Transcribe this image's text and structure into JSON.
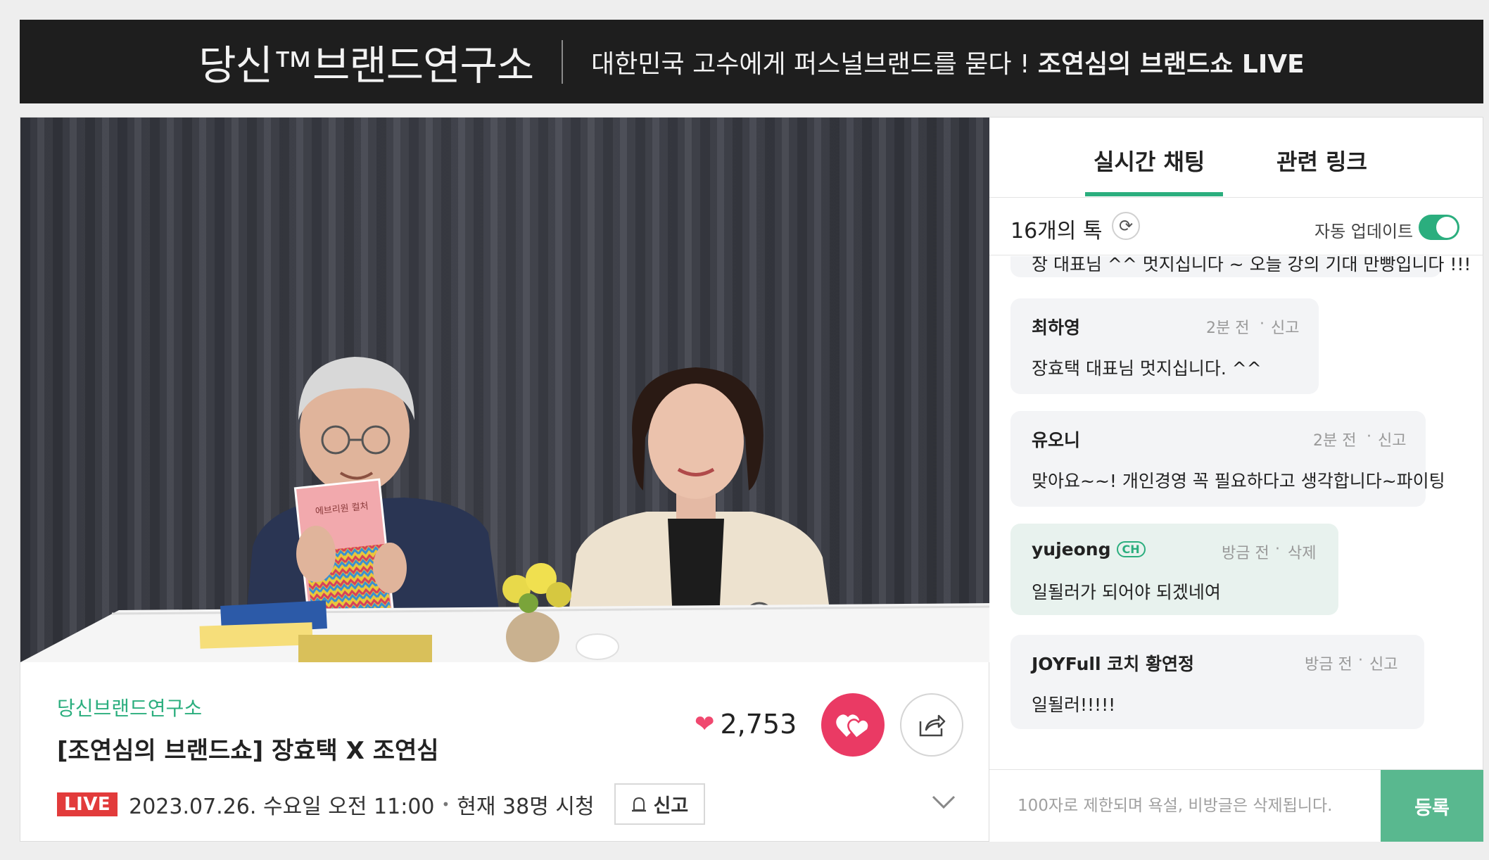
{
  "banner": {
    "logo": "당신™브랜드연구소",
    "tagline_normal": "대한민국 고수에게 퍼스널브랜드를 묻다 ! ",
    "tagline_bold": "조연심의 브랜드쇼 LIVE"
  },
  "video": {
    "book_title": "에브리원 컬처"
  },
  "info": {
    "channel": "당신브랜드연구소",
    "title": "[조연심의 브랜드쇼] 장효택 X 조연심",
    "live_badge": "LIVE",
    "datetime": "2023.07.26. 수요일 오전 11:00",
    "viewers": "현재 38명 시청",
    "report_label": "신고",
    "like_count": "2,753"
  },
  "chat": {
    "tabs": [
      "실시간 채팅",
      "관련 링크"
    ],
    "active_tab": 0,
    "talk_count": "16개의 톡",
    "auto_update_label": "자동 업데이트",
    "auto_update_on": true,
    "messages": [
      {
        "name": "",
        "time": "",
        "action": "",
        "text": "장 대표님 ^^ 멋지십니다 ~ 오늘 강의 기대 만빵입니다 !!!",
        "mine": false
      },
      {
        "name": "최하영",
        "time": "2분 전",
        "action": "신고",
        "text": "장효택 대표님 멋지십니다. ^^",
        "mine": false
      },
      {
        "name": "유오니",
        "time": "2분 전",
        "action": "신고",
        "text": "맞아요~~! 개인경영 꼭 필요하다고 생각합니다~파이팅",
        "mine": false
      },
      {
        "name": "yujeong",
        "badge": "CH",
        "time": "방금 전",
        "action": "삭제",
        "text": "일될러가 되어야 되겠네여",
        "mine": true
      },
      {
        "name": "JOYFull 코치 황연정",
        "time": "방금 전",
        "action": "신고",
        "text": "일될러!!!!!",
        "mine": false
      }
    ],
    "input_placeholder": "100자로 제한되며 욕설, 비방글은 삭제됩니다.",
    "submit_label": "등록"
  },
  "colors": {
    "accent": "#2bae7e",
    "like": "#ea3a64",
    "live": "#e23b3b",
    "banner_bg": "#1e1e1e"
  }
}
